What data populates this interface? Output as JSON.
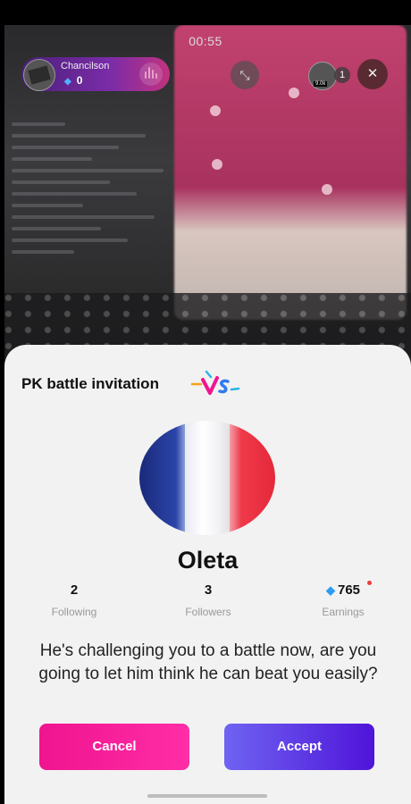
{
  "stream": {
    "timer": "00:55",
    "host": {
      "name": "Chancilson",
      "coins": "0"
    },
    "viewer_badge": "9.0k",
    "viewer_count": "1"
  },
  "invitation": {
    "title": "PK battle invitation",
    "opponent": {
      "name": "Oleta",
      "following_count": "2",
      "following_label": "Following",
      "followers_count": "3",
      "followers_label": "Followers",
      "earnings_count": "765",
      "earnings_label": "Earnings"
    },
    "message": "He's challenging you to a battle now, are you going to let him think he can beat you easily?",
    "cancel_label": "Cancel",
    "accept_label": "Accept"
  },
  "colors": {
    "cancel": "#f0148f",
    "accept": "#5a2ee0",
    "gem": "#2e9cf3",
    "notification_dot": "#f03b3b"
  },
  "icons": [
    "diamond-icon",
    "sound-wave-icon",
    "minimize-icon",
    "close-icon",
    "vs-icon"
  ]
}
